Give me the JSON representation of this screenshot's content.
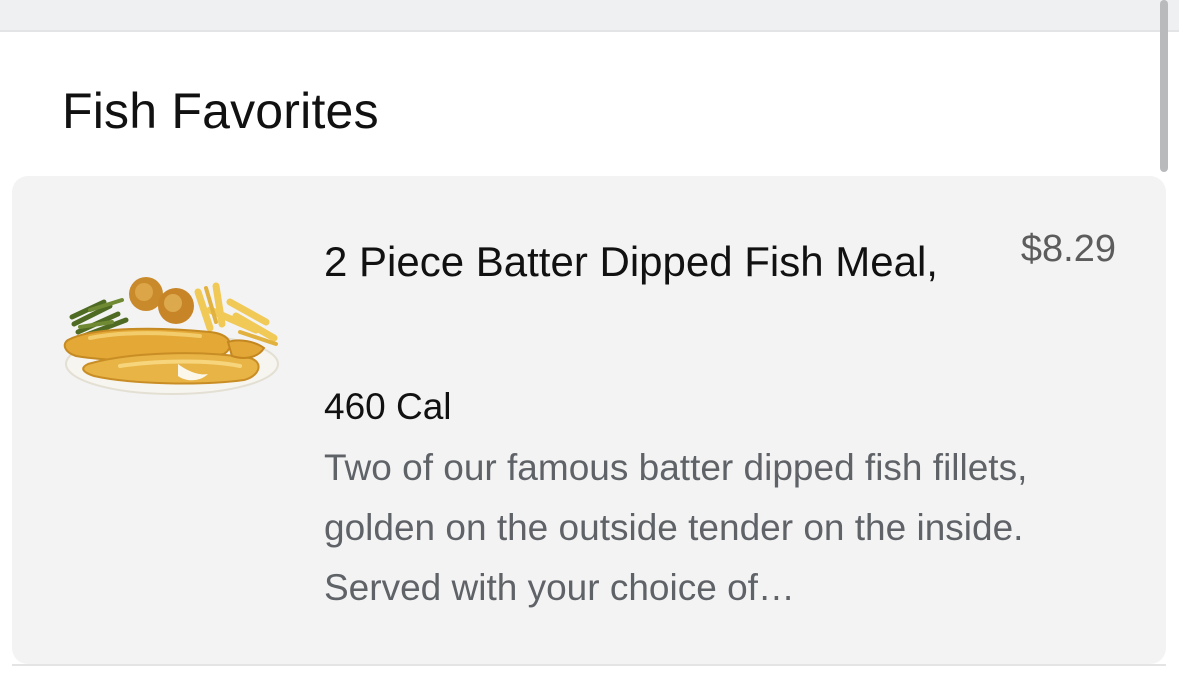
{
  "section": {
    "title": "Fish Favorites"
  },
  "item": {
    "name": "2 Piece Batter Dipped Fish Meal,",
    "price": "$8.29",
    "calories": "460 Cal",
    "description": "Two of our famous batter dipped fish fillets, golden on the outside tender on the inside. Served with your choice of…",
    "image_icon": "fish-meal-plate-image"
  },
  "colors": {
    "card_background": "#f3f3f3",
    "title_text": "#111111",
    "secondary_text": "#5f6368",
    "price_text": "#5c5c5c"
  }
}
